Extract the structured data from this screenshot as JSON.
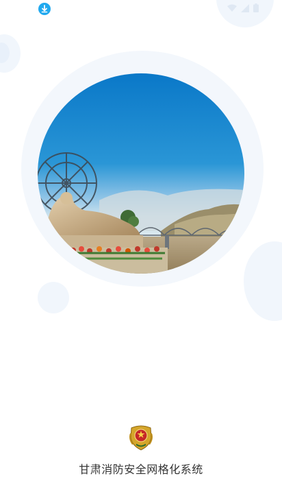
{
  "app": {
    "title": "甘肃消防安全网格化系统"
  },
  "status_bar": {
    "notification_icon": "download-icon",
    "icons": [
      "wifi-icon",
      "cellular-signal-icon",
      "battery-icon"
    ]
  },
  "splash": {
    "photo_subject": "lanzhou-yellow-river-mother-sculpture-waterwheel-bridge",
    "emblem_icon": "fire-rescue-emblem-icon"
  },
  "colors": {
    "background": "#ffffff",
    "bubble": "#f1f6fc",
    "accent_blue": "#21a9ef",
    "title_text": "#333333"
  }
}
